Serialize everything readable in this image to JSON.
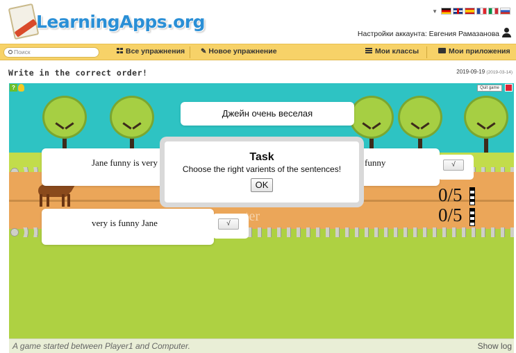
{
  "header": {
    "logo_text": "LearningApps.org",
    "account_label": "Настройки аккаунта: Евгения Рамазанова",
    "languages": [
      "de",
      "en",
      "es",
      "fr",
      "it",
      "ru"
    ]
  },
  "nav": {
    "search_placeholder": "Поиск",
    "all_exercises": "Все упражнения",
    "new_exercise": "Новое упражнение",
    "my_classes": "Мои классы",
    "my_apps": "Мои приложения"
  },
  "app": {
    "title": "Write in the correct order!",
    "date": "2019-09-19",
    "date_small": "(2019-03-14)"
  },
  "game": {
    "quit_label": "Quit game",
    "target_sentence": "Джейн очень веселая",
    "option_left_top": "Jane funny is very",
    "option_right_top": "funny",
    "option_left_bottom": "very is funny Jane",
    "check_glyph": "√",
    "score_player": "0/5",
    "score_computer": "0/5",
    "computer_label": "uter",
    "icons": [
      "help-icon",
      "bulb-icon",
      "fullscreen-icon"
    ]
  },
  "modal": {
    "title": "Task",
    "text": "Choose the right varients of the sentences!",
    "ok_label": "OK"
  },
  "status": {
    "text": "A game started between Player1 and Computer.",
    "show_log": "Show log"
  },
  "colors": {
    "sky": "#2ec3c3",
    "grass": "#aed142",
    "track": "#eba659",
    "nav_bar": "#f7d268",
    "logo": "#2a8fd6"
  }
}
